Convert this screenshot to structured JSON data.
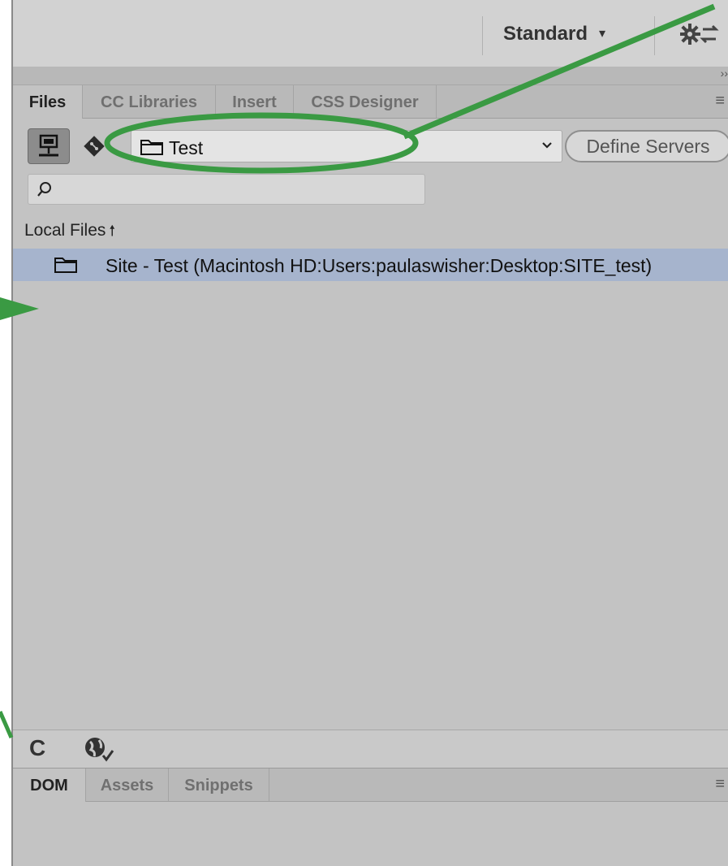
{
  "toolbar": {
    "workspace_label": "Standard",
    "workspace_caret": "▾",
    "sync_settings_icon": "gear-sync-icon"
  },
  "panel_tabs": [
    {
      "label": "Files",
      "active": true
    },
    {
      "label": "CC Libraries",
      "active": false
    },
    {
      "label": "Insert",
      "active": false
    },
    {
      "label": "CSS Designer",
      "active": false
    }
  ],
  "files_panel": {
    "site_select_value": "Test",
    "define_servers_label": "Define Servers",
    "search_placeholder": "",
    "local_files_label": "Local Files",
    "sort_arrow": "🠕",
    "rows": [
      {
        "label": "Site - Test (Macintosh HD:Users:paulaswisher:Desktop:SITE_test)",
        "selected": true
      }
    ]
  },
  "lower_tabs": [
    {
      "label": "DOM",
      "active": true
    },
    {
      "label": "Assets",
      "active": false
    },
    {
      "label": "Snippets",
      "active": false
    }
  ],
  "annotation": {
    "color": "#3a9a43"
  }
}
